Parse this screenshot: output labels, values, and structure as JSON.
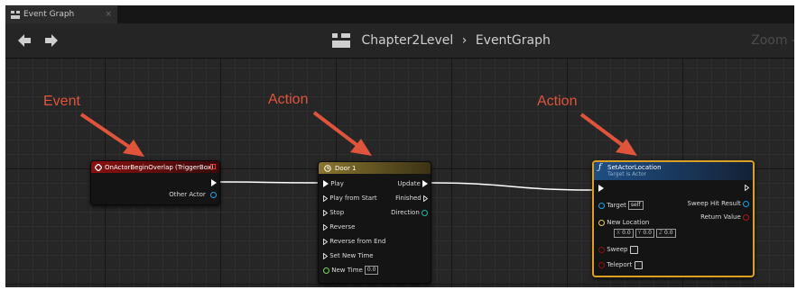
{
  "window": {
    "tab": {
      "label": "Event Graph",
      "close": "×"
    },
    "breadcrumb": {
      "blueprint": "Chapter2Level",
      "separator": "›",
      "graph": "EventGraph"
    },
    "zoom_label": "Zoom -"
  },
  "annotations": [
    {
      "label": "Event",
      "color": "#e0543c"
    },
    {
      "label": "Action",
      "color": "#e0543c"
    },
    {
      "label": "Action",
      "color": "#e0543c"
    }
  ],
  "nodes": {
    "event": {
      "title": "OnActorBeginOverlap (TriggerBox)",
      "header_color": "#7a1010",
      "pins": {
        "other_actor": "Other Actor"
      }
    },
    "timeline": {
      "title": "Door 1",
      "header_color": "#7d6a2a",
      "inputs": {
        "play": "Play",
        "play_from_start": "Play from Start",
        "stop": "Stop",
        "reverse": "Reverse",
        "reverse_from_end": "Reverse from End",
        "set_new_time": "Set New Time",
        "new_time": "New Time",
        "new_time_value": "0.0"
      },
      "outputs": {
        "update": "Update",
        "finished": "Finished",
        "direction": "Direction"
      }
    },
    "set_location": {
      "title": "SetActorLocation",
      "subtitle": "Target is Actor",
      "header_color": "#1f4a7a",
      "border_color": "#d9a024",
      "inputs": {
        "target": "Target",
        "target_value": "self",
        "new_location": "New Location",
        "x_label": "X",
        "x_value": "0.0",
        "y_label": "Y",
        "y_value": "0.0",
        "z_label": "Z",
        "z_value": "0.0",
        "sweep": "Sweep",
        "teleport": "Teleport"
      },
      "outputs": {
        "sweep_hit_result": "Sweep Hit Result",
        "return_value": "Return Value"
      }
    }
  },
  "colors": {
    "exec_wire": "#ffffff",
    "object_pin": "#1aa1e6",
    "bool_pin": "#8c1212",
    "float_pin": "#7ed957",
    "vector_pin": "#f2c94c"
  }
}
